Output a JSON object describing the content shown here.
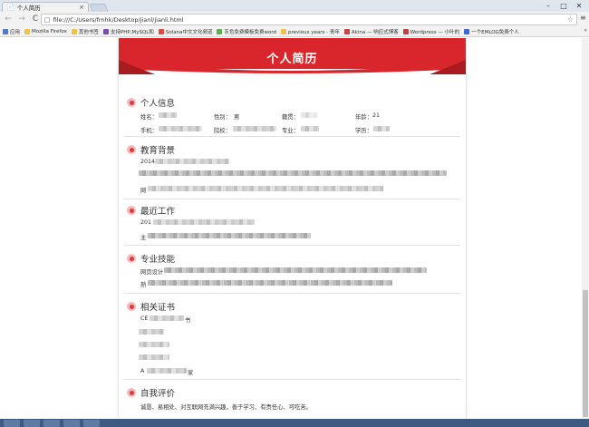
{
  "browser": {
    "tab_title": "个人简历",
    "tab_close": "×",
    "url": "file:///C:/Users/frnhk/Desktop/jianl/jianli.html",
    "window_controls": {
      "minimize": "–",
      "maximize": "□",
      "close": "✕"
    },
    "nav": {
      "back": "←",
      "forward": "→",
      "reload": "C"
    },
    "star": "☆",
    "menu": "≡",
    "bookmarks_more": "»",
    "bookmarks": [
      {
        "label": "应用",
        "color": "#4a7bd0"
      },
      {
        "label": "Mozilla Firefox",
        "color": "#f0c24a"
      },
      {
        "label": "其他书签",
        "color": "#f0c24a"
      },
      {
        "label": "支持PHP,MySQL和",
        "color": "#7a4bb0"
      },
      {
        "label": "Solana中文文化频道",
        "color": "#e04a3a"
      },
      {
        "label": "灰色免费模板免费word",
        "color": "#5ab050"
      },
      {
        "label": "previous years - 青年",
        "color": "#f0c24a"
      },
      {
        "label": "Akina — 响应式博客",
        "color": "#d04040"
      },
      {
        "label": "Wordpress — 小叶的",
        "color": "#c04040"
      },
      {
        "label": "一个EMLOG免费个人",
        "color": "#3a6ad0"
      }
    ]
  },
  "resume": {
    "title": "个人简历",
    "personal": {
      "title": "个人信息",
      "name_label": "姓名：",
      "gender_label": "性别：",
      "gender_value": "男",
      "origin_label": "籍贯：",
      "age_label": "年龄：",
      "age_value": "21",
      "phone_label": "手机：",
      "school_label": "院校：",
      "major_label": "专业：",
      "degree_label": "学历："
    },
    "education": {
      "title": "教育背景",
      "year_text": "2014",
      "line3_prefix": "网"
    },
    "work": {
      "title": "最近工作",
      "year_text": "201",
      "line2_prefix": "主"
    },
    "skills": {
      "title": "专业技能",
      "line1_prefix": "网页设计",
      "line2_prefix": "熟"
    },
    "certs": {
      "title": "相关证书",
      "line1_prefix": "CE",
      "line1_suffix": "书",
      "last_prefix": "A",
      "last_suffix": "家"
    },
    "self_eval": {
      "title": "自我评价",
      "text": "诚恳、易相处、对互联网充满兴趣，善于学习、有责任心、可吃苦。"
    }
  },
  "colors": {
    "accent": "#d9262c",
    "accent_dark": "#a81c20",
    "dot": "#e0393e"
  }
}
